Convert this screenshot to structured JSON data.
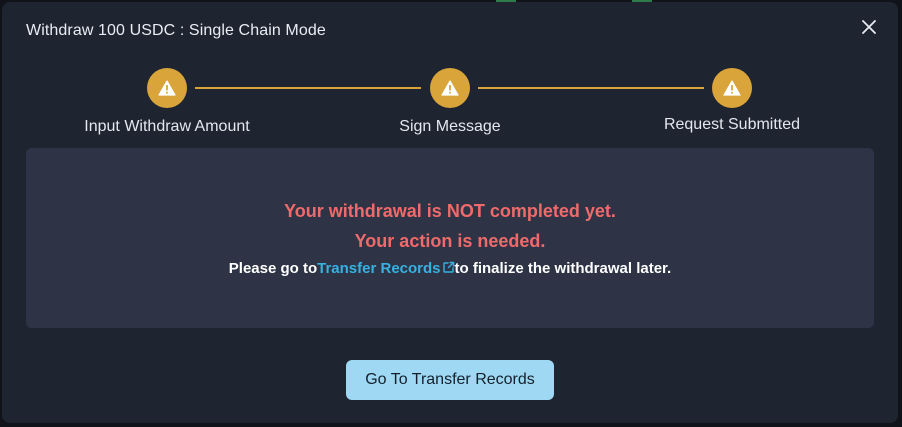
{
  "dialog": {
    "title": "Withdraw 100 USDC : Single Chain Mode",
    "close_icon": "close-icon"
  },
  "stepper": {
    "accent_color": "#d9a53a",
    "steps": [
      {
        "label": "Input Withdraw Amount",
        "icon": "warning-icon"
      },
      {
        "label": "Sign Message",
        "icon": "warning-icon"
      },
      {
        "label": "Request Submitted",
        "icon": "warning-icon"
      }
    ]
  },
  "status": {
    "error_color": "#ef6a6a",
    "line1": "Your withdrawal is NOT completed yet.",
    "line2": "Your action is needed.",
    "info_prefix": "Please go to",
    "info_link": "Transfer Records",
    "info_link_icon": "external-link-icon",
    "info_suffix": "to finalize the withdrawal later."
  },
  "actions": {
    "primary_label": "Go To Transfer Records"
  }
}
